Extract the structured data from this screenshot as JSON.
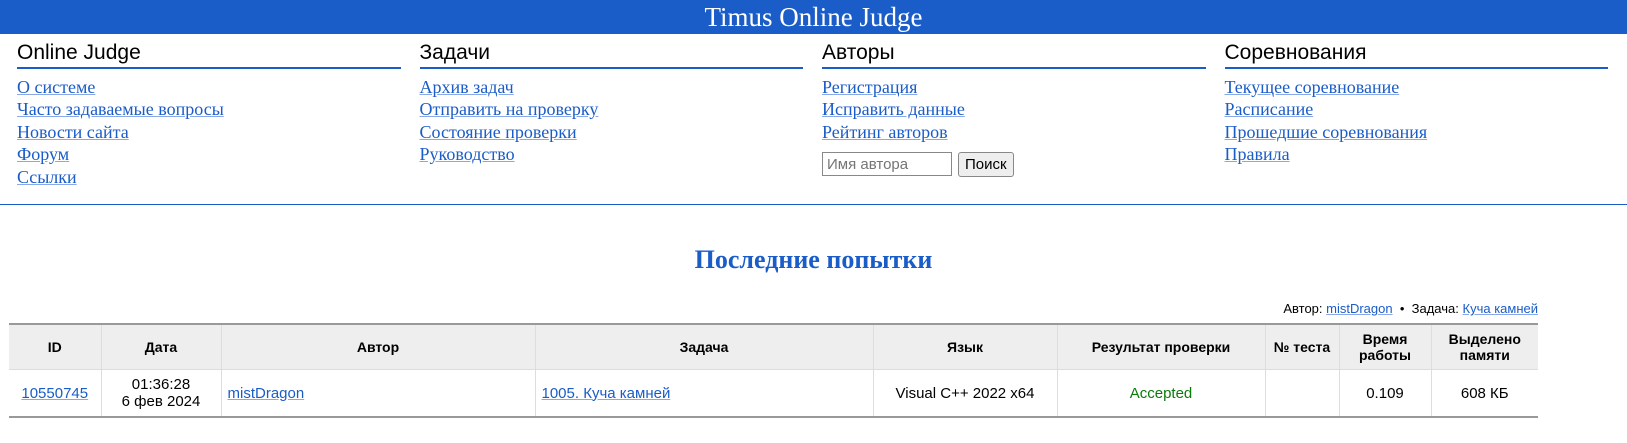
{
  "title": "Timus Online Judge",
  "menu": [
    {
      "heading": "Online Judge",
      "links": [
        "О системе",
        "Часто задаваемые вопросы",
        "Новости сайта",
        "Форум",
        "Ссылки"
      ]
    },
    {
      "heading": "Задачи",
      "links": [
        "Архив задач",
        "Отправить на проверку",
        "Состояние проверки",
        "Руководство"
      ]
    },
    {
      "heading": "Авторы",
      "links": [
        "Регистрация",
        "Исправить данные",
        "Рейтинг авторов"
      ],
      "search_placeholder": "Имя автора",
      "search_button": "Поиск"
    },
    {
      "heading": "Соревнования",
      "links": [
        "Текущее соревнование",
        "Расписание",
        "Прошедшие соревнования",
        "Правила"
      ]
    }
  ],
  "page_title": "Последние попытки",
  "filter": {
    "author_label": "Автор:",
    "author": "mistDragon",
    "sep": "•",
    "problem_label": "Задача:",
    "problem": "Куча камней"
  },
  "table": {
    "headers": [
      "ID",
      "Дата",
      "Автор",
      "Задача",
      "Язык",
      "Результат проверки",
      "№ теста",
      "Время работы",
      "Выделено памяти"
    ],
    "rows": [
      {
        "id": "10550745",
        "time": "01:36:28",
        "date": "6 фев 2024",
        "author": "mistDragon",
        "problem": "1005. Куча камней",
        "language": "Visual C++ 2022 x64",
        "verdict": "Accepted",
        "test": "",
        "runtime": "0.109",
        "memory": "608 КБ"
      }
    ]
  },
  "colors": {
    "brand": "#1b5dc8",
    "accepted": "#0a7a0a"
  }
}
